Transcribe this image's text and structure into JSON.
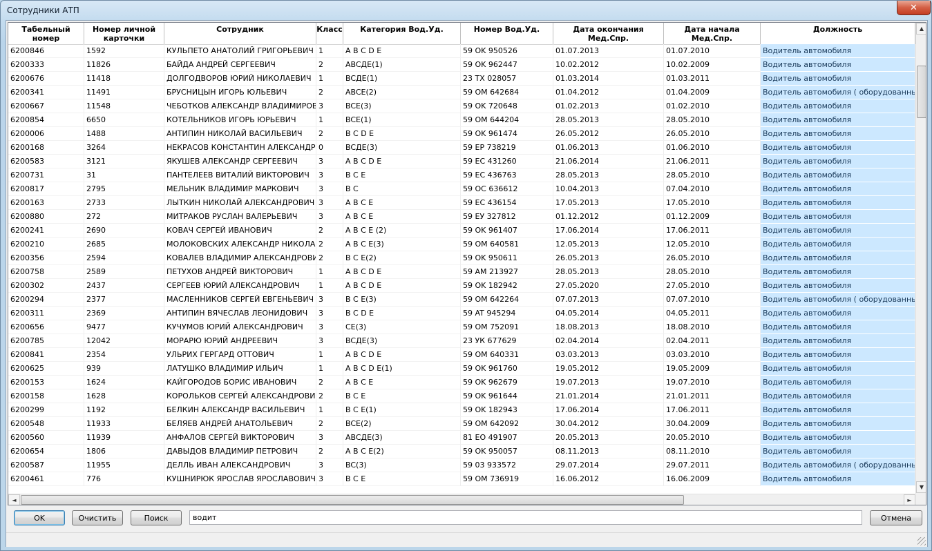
{
  "window": {
    "title": "Сотрудники АТП",
    "close_glyph": "✕"
  },
  "columns": [
    {
      "key": "tab",
      "label": "Табельный номер"
    },
    {
      "key": "card",
      "label": "Номер личной карточки"
    },
    {
      "key": "name",
      "label": "Сотрудник"
    },
    {
      "key": "cls",
      "label": "Класс"
    },
    {
      "key": "cat",
      "label": "Категория Вод.Уд."
    },
    {
      "key": "lic",
      "label": "Номер Вод.Уд."
    },
    {
      "key": "end",
      "label": "Дата окончания Мед.Спр."
    },
    {
      "key": "start",
      "label": "Дата начала Мед.Спр."
    },
    {
      "key": "pos",
      "label": "Должность"
    }
  ],
  "rows": [
    {
      "tab": "6200846",
      "card": "1592",
      "name": "КУЛЬПЕТО АНАТОЛИЙ ГРИГОРЬЕВИЧ",
      "cls": "1",
      "cat": "A B C D E",
      "lic": "59 OK 950526",
      "end": "01.07.2013",
      "start": "01.07.2010",
      "pos": "Водитель автомобиля"
    },
    {
      "tab": "6200333",
      "card": "11826",
      "name": "БАЙДА АНДРЕЙ СЕРГЕЕВИЧ",
      "cls": "2",
      "cat": "ABCДE(1)",
      "lic": "59 OK 962447",
      "end": "10.02.2012",
      "start": "10.02.2009",
      "pos": "Водитель автомобиля"
    },
    {
      "tab": "6200676",
      "card": "11418",
      "name": "ДОЛГОДВОРОВ ЮРИЙ НИКОЛАЕВИЧ",
      "cls": "1",
      "cat": "BCДE(1)",
      "lic": "23 TX 028057",
      "end": "01.03.2014",
      "start": "01.03.2011",
      "pos": "Водитель автомобиля"
    },
    {
      "tab": "6200341",
      "card": "11491",
      "name": "БРУСНИЦЫН ИГОРЬ ЮЛЬЕВИЧ",
      "cls": "2",
      "cat": "ABCE(2)",
      "lic": "59 OM 642684",
      "end": "01.04.2012",
      "start": "01.04.2009",
      "pos": "Водитель автомобиля ( оборудованный гид"
    },
    {
      "tab": "6200667",
      "card": "11548",
      "name": "ЧЕБОТКОВ АЛЕКСАНДР ВЛАДИМИРОВИ",
      "cls": "3",
      "cat": "BCE(3)",
      "lic": "59 OK 720648",
      "end": "01.02.2013",
      "start": "01.02.2010",
      "pos": "Водитель автомобиля"
    },
    {
      "tab": "6200854",
      "card": "6650",
      "name": "КОТЕЛЬНИКОВ ИГОРЬ ЮРЬЕВИЧ",
      "cls": "1",
      "cat": "BCE(1)",
      "lic": "59 OM 644204",
      "end": "28.05.2013",
      "start": "28.05.2010",
      "pos": "Водитель автомобиля"
    },
    {
      "tab": "6200006",
      "card": "1488",
      "name": "АНТИПИН НИКОЛАЙ ВАСИЛЬЕВИЧ",
      "cls": "2",
      "cat": "B C D E",
      "lic": "59 OK 961474",
      "end": "26.05.2012",
      "start": "26.05.2010",
      "pos": "Водитель автомобиля"
    },
    {
      "tab": "6200168",
      "card": "3264",
      "name": "НЕКРАСОВ КОНСТАНТИН АЛЕКСАНДРОЕ",
      "cls": "0",
      "cat": "BCДE(3)",
      "lic": "59 EP 738219",
      "end": "01.06.2013",
      "start": "01.06.2010",
      "pos": "Водитель автомобиля"
    },
    {
      "tab": "6200583",
      "card": "3121",
      "name": "ЯКУШЕВ АЛЕКСАНДР СЕРГЕЕВИЧ",
      "cls": "3",
      "cat": "A B C D E",
      "lic": "59 EC 431260",
      "end": "21.06.2014",
      "start": "21.06.2011",
      "pos": "Водитель автомобиля"
    },
    {
      "tab": "6200731",
      "card": "31",
      "name": "ПАНТЕЛЕЕВ ВИТАЛИЙ ВИКТОРОВИЧ",
      "cls": "3",
      "cat": "B C E",
      "lic": "59 EC 436763",
      "end": "28.05.2013",
      "start": "28.05.2010",
      "pos": "Водитель автомобиля"
    },
    {
      "tab": "6200817",
      "card": "2795",
      "name": "МЕЛЬНИК ВЛАДИМИР МАРКОВИЧ",
      "cls": "3",
      "cat": "B C",
      "lic": "59 OC 636612",
      "end": "10.04.2013",
      "start": "07.04.2010",
      "pos": "Водитель автомобиля"
    },
    {
      "tab": "6200163",
      "card": "2733",
      "name": "ЛЫТКИН НИКОЛАЙ АЛЕКСАНДРОВИЧ",
      "cls": "3",
      "cat": "A B C E",
      "lic": "59 EC 436154",
      "end": "17.05.2013",
      "start": "17.05.2010",
      "pos": "Водитель автомобиля"
    },
    {
      "tab": "6200880",
      "card": "272",
      "name": "МИТРАКОВ РУСЛАН ВАЛЕРЬЕВИЧ",
      "cls": "3",
      "cat": "A B C E",
      "lic": "59 EУ 327812",
      "end": "01.12.2012",
      "start": "01.12.2009",
      "pos": "Водитель автомобиля"
    },
    {
      "tab": "6200241",
      "card": "2690",
      "name": "КОВАЧ СЕРГЕЙ ИВАНОВИЧ",
      "cls": "2",
      "cat": "A B C E (2)",
      "lic": "59 OK 961407",
      "end": "17.06.2014",
      "start": "17.06.2011",
      "pos": "Водитель автомобиля"
    },
    {
      "tab": "6200210",
      "card": "2685",
      "name": "МОЛОКОВСКИХ АЛЕКСАНДР НИКОЛАЕВІ",
      "cls": "2",
      "cat": "A B C E(3)",
      "lic": "59 OM 640581",
      "end": "12.05.2013",
      "start": "12.05.2010",
      "pos": "Водитель автомобиля"
    },
    {
      "tab": "6200356",
      "card": "2594",
      "name": "КОВАЛЕВ ВЛАДИМИР АЛЕКСАНДРОВИЧ",
      "cls": "2",
      "cat": "B C E(2)",
      "lic": "59 OK 950611",
      "end": "26.05.2013",
      "start": "26.05.2010",
      "pos": "Водитель автомобиля"
    },
    {
      "tab": "6200758",
      "card": "2589",
      "name": "ПЕТУХОВ АНДРЕЙ ВИКТОРОВИЧ",
      "cls": "1",
      "cat": "A B C D E",
      "lic": "59 AM 213927",
      "end": "28.05.2013",
      "start": "28.05.2010",
      "pos": "Водитель автомобиля"
    },
    {
      "tab": "6200302",
      "card": "2437",
      "name": "СЕРГЕЕВ ЮРИЙ АЛЕКСАНДРОВИЧ",
      "cls": "1",
      "cat": "A B C D E",
      "lic": "59 OK 182942",
      "end": "27.05.2020",
      "start": "27.05.2010",
      "pos": "Водитель автомобиля"
    },
    {
      "tab": "6200294",
      "card": "2377",
      "name": "МАСЛЕННИКОВ СЕРГЕЙ ЕВГЕНЬЕВИЧ",
      "cls": "3",
      "cat": "B C E(3)",
      "lic": "59 OM 642264",
      "end": "07.07.2013",
      "start": "07.07.2010",
      "pos": "Водитель автомобиля ( оборудованный гид"
    },
    {
      "tab": "6200311",
      "card": "2369",
      "name": "АНТИПИН ВЯЧЕСЛАВ ЛЕОНИДОВИЧ",
      "cls": "3",
      "cat": "B C D E",
      "lic": "59 AT 945294",
      "end": "04.05.2014",
      "start": "04.05.2011",
      "pos": "Водитель автомобиля"
    },
    {
      "tab": "6200656",
      "card": "9477",
      "name": "КУЧУМОВ ЮРИЙ АЛЕКСАНДРОВИЧ",
      "cls": "3",
      "cat": "CE(3)",
      "lic": "59 OM 752091",
      "end": "18.08.2013",
      "start": "18.08.2010",
      "pos": "Водитель автомобиля"
    },
    {
      "tab": "6200785",
      "card": "12042",
      "name": "МОРАРЮ ЮРИЙ АНДРЕЕВИЧ",
      "cls": "3",
      "cat": "BCДE(3)",
      "lic": "23 УК 677629",
      "end": "02.04.2014",
      "start": "02.04.2011",
      "pos": "Водитель автомобиля"
    },
    {
      "tab": "6200841",
      "card": "2354",
      "name": "УЛЬРИХ ГЕРГАРД ОТТОВИЧ",
      "cls": "1",
      "cat": "A B C D E",
      "lic": "59 OM 640331",
      "end": "03.03.2013",
      "start": "03.03.2010",
      "pos": "Водитель автомобиля"
    },
    {
      "tab": "6200625",
      "card": "939",
      "name": "ЛАТУШКО ВЛАДИМИР ИЛЬИЧ",
      "cls": "1",
      "cat": "A B C D E(1)",
      "lic": "59  OK 961760",
      "end": "19.05.2012",
      "start": "19.05.2009",
      "pos": "Водитель автомобиля"
    },
    {
      "tab": "6200153",
      "card": "1624",
      "name": "КАЙГОРОДОВ БОРИС ИВАНОВИЧ",
      "cls": "2",
      "cat": "A B C E",
      "lic": "59 OK 962679",
      "end": "19.07.2013",
      "start": "19.07.2010",
      "pos": "Водитель автомобиля"
    },
    {
      "tab": "6200158",
      "card": "1628",
      "name": "КОРОЛЬКОВ СЕРГЕЙ АЛЕКСАНДРОВИЧ",
      "cls": "2",
      "cat": "B C E",
      "lic": "59 OK 961644",
      "end": "21.01.2014",
      "start": "21.01.2011",
      "pos": "Водитель автомобиля"
    },
    {
      "tab": "6200299",
      "card": "1192",
      "name": "БЕЛКИН АЛЕКСАНДР ВАСИЛЬЕВИЧ",
      "cls": "1",
      "cat": "B C E(1)",
      "lic": "59 OK 182943",
      "end": "17.06.2014",
      "start": "17.06.2011",
      "pos": "Водитель автомобиля"
    },
    {
      "tab": "6200548",
      "card": "11933",
      "name": "БЕЛЯЕВ АНДРЕЙ АНАТОЛЬЕВИЧ",
      "cls": "2",
      "cat": "BCE(2)",
      "lic": "59 OM 642092",
      "end": "30.04.2012",
      "start": "30.04.2009",
      "pos": "Водитель автомобиля"
    },
    {
      "tab": "6200560",
      "card": "11939",
      "name": "АНФАЛОВ СЕРГЕЙ ВИКТОРОВИЧ",
      "cls": "3",
      "cat": "ABCДE(3)",
      "lic": "81 EO 491907",
      "end": "20.05.2013",
      "start": "20.05.2010",
      "pos": "Водитель автомобиля"
    },
    {
      "tab": "6200654",
      "card": "1806",
      "name": "ДАВЫДОВ ВЛАДИМИР ПЕТРОВИЧ",
      "cls": "2",
      "cat": "A B C E(2)",
      "lic": "59 OK 950057",
      "end": "08.11.2013",
      "start": "08.11.2010",
      "pos": "Водитель автомобиля"
    },
    {
      "tab": "6200587",
      "card": "11955",
      "name": "ДЕЛЛЬ ИВАН АЛЕКСАНДРОВИЧ",
      "cls": "3",
      "cat": "BC(3)",
      "lic": "59 03 933572",
      "end": "29.07.2014",
      "start": "29.07.2011",
      "pos": "Водитель автомобиля ( оборудованный гид"
    },
    {
      "tab": "6200461",
      "card": "776",
      "name": "КУШНИРЮК ЯРОСЛАВ ЯРОСЛАВОВИЧ",
      "cls": "3",
      "cat": " B C E",
      "lic": "59 OM 736919",
      "end": "16.06.2012",
      "start": "16.06.2009",
      "pos": "Водитель автомобиля"
    }
  ],
  "buttons": {
    "ok": "OK",
    "clear": "Очистить",
    "search": "Поиск",
    "cancel": "Отмена"
  },
  "search": {
    "value": "водит"
  },
  "scroll": {
    "up": "▲",
    "down": "▼",
    "left": "◄",
    "right": "►"
  },
  "colors": {
    "selected_position_bg": "#cce8ff",
    "close_button": "#c43d22"
  }
}
